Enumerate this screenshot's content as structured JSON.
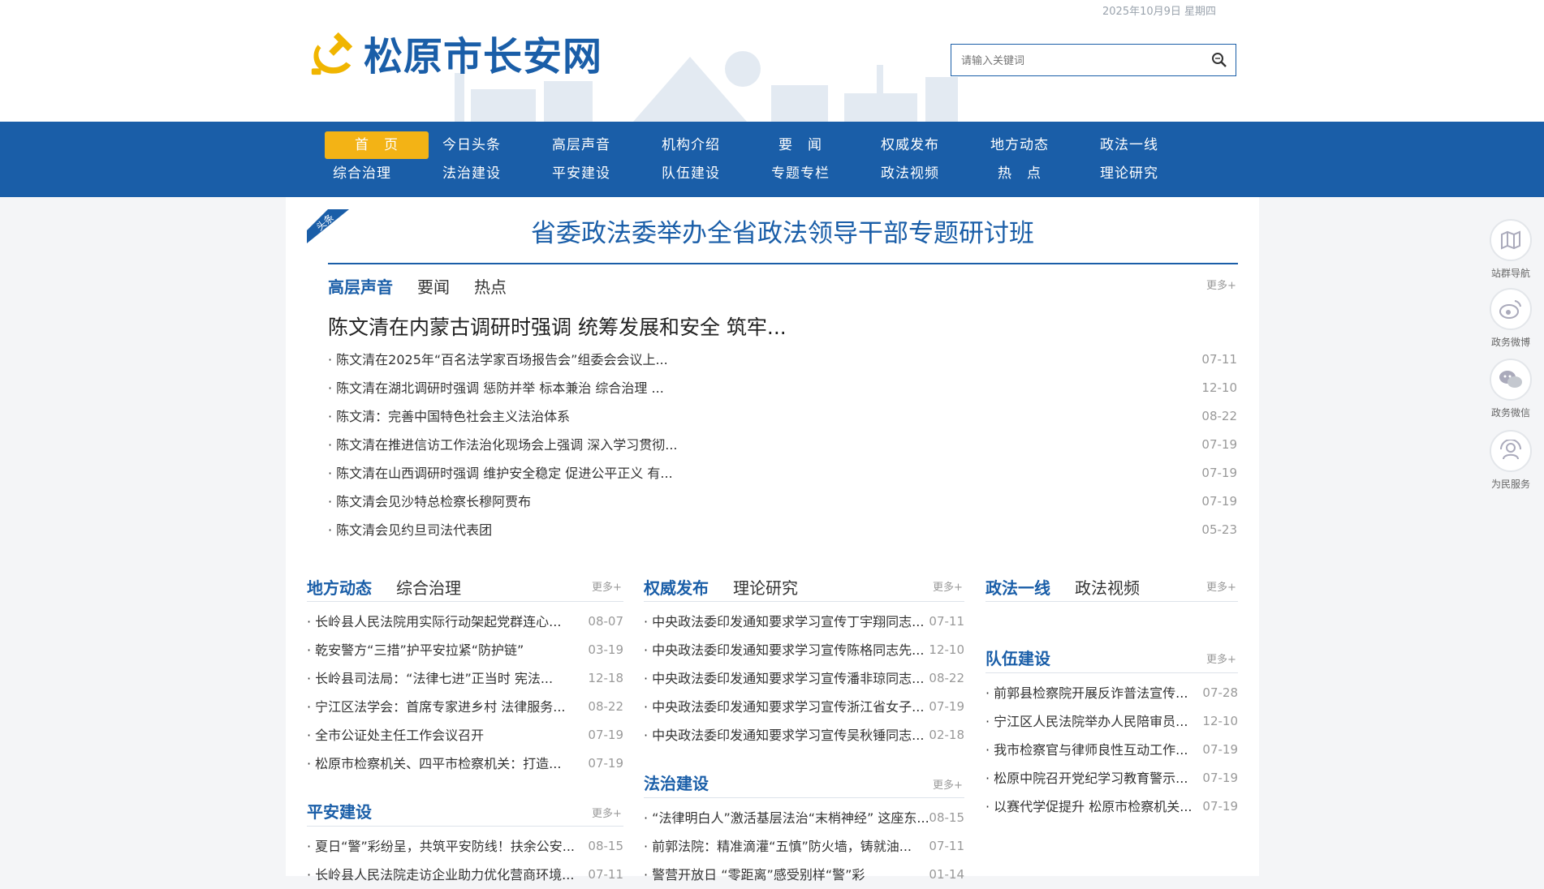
{
  "header": {
    "date": "2025年10月9日 星期四",
    "site_name": "松原市长安网",
    "search_placeholder": "请输入关键词"
  },
  "nav": {
    "items": [
      "首　页",
      "今日头条",
      "高层声音",
      "机构介绍",
      "要　闻",
      "权威发布",
      "地方动态",
      "政法一线",
      "综合治理",
      "法治建设",
      "平安建设",
      "队伍建设",
      "专题专栏",
      "政法视频",
      "热　点",
      "理论研究"
    ],
    "active": "首　页"
  },
  "headline": {
    "badge": "头条",
    "title": "省委政法委举办全省政法领导干部专题研讨班"
  },
  "top_news": {
    "tabs": [
      "高层声音",
      "要闻",
      "热点"
    ],
    "more": "更多+",
    "lead": "陈文清在内蒙古调研时强调 统筹发展和安全 筑牢...",
    "items": [
      {
        "title": "· 陈文清在2025年“百名法学家百场报告会”组委会会议上...",
        "date": "07-11"
      },
      {
        "title": "· 陈文清在湖北调研时强调 惩防并举 标本兼治 综合治理 ...",
        "date": "12-10"
      },
      {
        "title": "· 陈文清：完善中国特色社会主义法治体系",
        "date": "08-22"
      },
      {
        "title": "· 陈文清在推进信访工作法治化现场会上强调 深入学习贯彻...",
        "date": "07-19"
      },
      {
        "title": "· 陈文清在山西调研时强调 维护安全稳定 促进公平正义 有...",
        "date": "07-19"
      },
      {
        "title": "· 陈文清会见沙特总检察长穆阿贾布",
        "date": "07-19"
      },
      {
        "title": "· 陈文清会见约旦司法代表团",
        "date": "05-23"
      }
    ]
  },
  "col1": {
    "tabs": [
      "地方动态",
      "综合治理"
    ],
    "more": "更多+",
    "items": [
      {
        "title": "· 长岭县人民法院用实际行动架起党群连心...",
        "date": "08-07"
      },
      {
        "title": "· 乾安警方“三措”护平安拉紧“防护链”",
        "date": "03-19"
      },
      {
        "title": "· 长岭县司法局：“法律七进”正当时 宪法...",
        "date": "12-18"
      },
      {
        "title": "· 宁江区法学会：首席专家进乡村 法律服务...",
        "date": "08-22"
      },
      {
        "title": "· 全市公证处主任工作会议召开",
        "date": "07-19"
      },
      {
        "title": "· 松原市检察机关、四平市检察机关：打造...",
        "date": "07-19"
      }
    ],
    "section2": {
      "title": "平安建设",
      "more": "更多+",
      "items": [
        {
          "title": "· 夏日“警”彩纷呈，共筑平安防线！扶余公安...",
          "date": "08-15"
        },
        {
          "title": "· 长岭县人民法院走访企业助力优化营商环境...",
          "date": "07-11"
        }
      ]
    }
  },
  "col2": {
    "tabs": [
      "权威发布",
      "理论研究"
    ],
    "more": "更多+",
    "items": [
      {
        "title": "· 中央政法委印发通知要求学习宣传丁宇翔同志...",
        "date": "07-11"
      },
      {
        "title": "· 中央政法委印发通知要求学习宣传陈格同志先...",
        "date": "12-10"
      },
      {
        "title": "· 中央政法委印发通知要求学习宣传潘非琼同志...",
        "date": "08-22"
      },
      {
        "title": "· 中央政法委印发通知要求学习宣传浙江省女子...",
        "date": "07-19"
      },
      {
        "title": "· 中央政法委印发通知要求学习宣传吴秋锤同志...",
        "date": "02-18"
      }
    ],
    "section2": {
      "title": "法治建设",
      "more": "更多+",
      "items": [
        {
          "title": "· “法律明白人”激活基层法治“末梢神经” 这座东...",
          "date": "08-15"
        },
        {
          "title": "· 前郭法院：精准滴灌“五慎”防火墙，铸就油...",
          "date": "07-11"
        },
        {
          "title": "· 警营开放日 “零距离”感受别样“警”彩",
          "date": "01-14"
        }
      ]
    }
  },
  "col3": {
    "tabs": [
      "政法一线",
      "政法视频"
    ],
    "more": "更多+",
    "section2": {
      "title": "队伍建设",
      "more": "更多+",
      "items": [
        {
          "title": "· 前郭县检察院开展反诈普法宣传...",
          "date": "07-28"
        },
        {
          "title": "· 宁江区人民法院举办人民陪审员...",
          "date": "12-10"
        },
        {
          "title": "· 我市检察官与律师良性互动工作...",
          "date": "07-19"
        },
        {
          "title": "· 松原中院召开党纪学习教育警示...",
          "date": "07-19"
        },
        {
          "title": "· 以赛代学促提升 松原市检察机关...",
          "date": "07-19"
        }
      ]
    }
  },
  "sidebar": {
    "items": [
      "站群导航",
      "政务微博",
      "政务微信",
      "为民服务"
    ]
  },
  "colors": {
    "primary": "#1a5ea8",
    "accent": "#f3b315",
    "emblem": "#f0b500"
  }
}
